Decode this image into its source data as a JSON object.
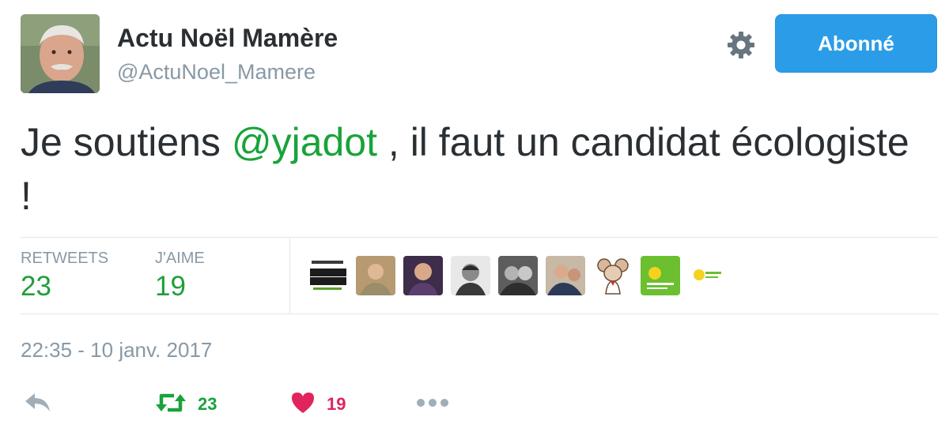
{
  "author": {
    "name": "Actu Noël Mamère",
    "handle": "@ActuNoel_Mamere"
  },
  "follow_button": {
    "label": "Abonné"
  },
  "tweet": {
    "text_before": "Je soutiens ",
    "mention": "@yjadot",
    "text_after": " , il faut un candidat écologiste !"
  },
  "stats": {
    "retweets_label": "RETWEETS",
    "retweets_value": "23",
    "likes_label": "J'AIME",
    "likes_value": "19"
  },
  "liker_avatars": [
    "justice-climatique-logo",
    "person-avatar",
    "person-avatar",
    "person-avatar",
    "person-avatar",
    "person-avatar",
    "cartoon-mouse-avatar",
    "ecologie-logo",
    "ecologie-logo"
  ],
  "timestamp": "22:35 - 10 janv. 2017",
  "actions": {
    "retweet_count": "23",
    "like_count": "19"
  },
  "colors": {
    "accent_green": "#19a33a",
    "follow_blue": "#2b9de8",
    "like_red": "#e0245e",
    "muted": "#8899a6"
  }
}
